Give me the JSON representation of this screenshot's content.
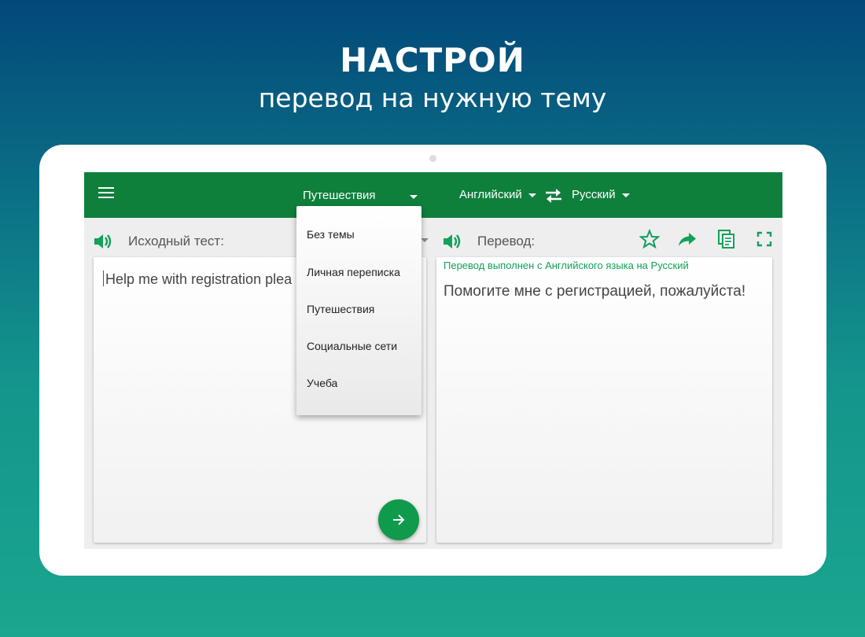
{
  "promo": {
    "headline": "НАСТРОЙ",
    "subline": "перевод на нужную тему"
  },
  "appbar": {
    "topic_selected": "Путешествия",
    "source_language": "Английский",
    "target_language": "Русский",
    "bar_color": "#0f7f3c"
  },
  "source_pane": {
    "title": "Исходный тест:",
    "input_value": "Help me with registration plea"
  },
  "target_pane": {
    "title": "Перевод:",
    "note": "Перевод выполнен с Английского языка на Русский",
    "output_text": "Помогите мне с регистрацией, пожалуйста!"
  },
  "topic_menu": {
    "items": [
      {
        "label": "Без темы"
      },
      {
        "label": "Личная переписка"
      },
      {
        "label": "Путешествия"
      },
      {
        "label": "Социальные сети"
      },
      {
        "label": "Учеба"
      }
    ]
  },
  "icons": {
    "menu": "hamburger-icon",
    "swap": "swap-icon",
    "speaker": "speaker-icon",
    "favorite": "star-icon",
    "share": "share-icon",
    "copy": "copy-icon",
    "fullscreen": "fullscreen-icon",
    "translate": "arrow-right-icon"
  },
  "colors": {
    "accent": "#12a05a",
    "fab": "#0f9a4c"
  }
}
